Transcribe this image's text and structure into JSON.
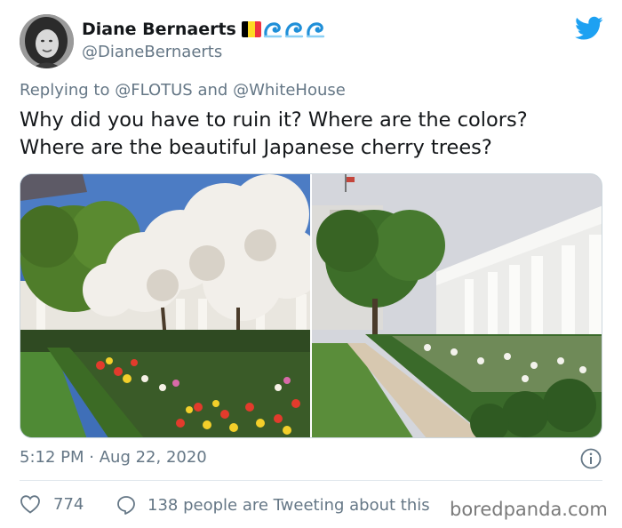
{
  "author": {
    "name": "Diane Bernaerts",
    "handle": "@DianeBernaerts"
  },
  "emojis": [
    "belgian-flag-icon",
    "wave-icon",
    "wave-icon",
    "wave-icon"
  ],
  "reply": {
    "prefix": "Replying to",
    "mention1": "@FLOTUS",
    "and": "and",
    "mention2": "@WhiteHouse"
  },
  "tweet": {
    "line1": "Why did you have to ruin it? Where are the colors?",
    "line2": "Where are the beautiful Japanese cherry trees?"
  },
  "meta": {
    "time": "5:12 PM",
    "separator": "·",
    "date": "Aug 22, 2020"
  },
  "engagement": {
    "likes": "774",
    "tweeting": "138 people are Tweeting about this"
  },
  "watermark": "boredpanda.com",
  "colors": {
    "twitter_blue": "#1da1f2",
    "secondary_text": "#657786",
    "primary_text": "#14171a"
  }
}
